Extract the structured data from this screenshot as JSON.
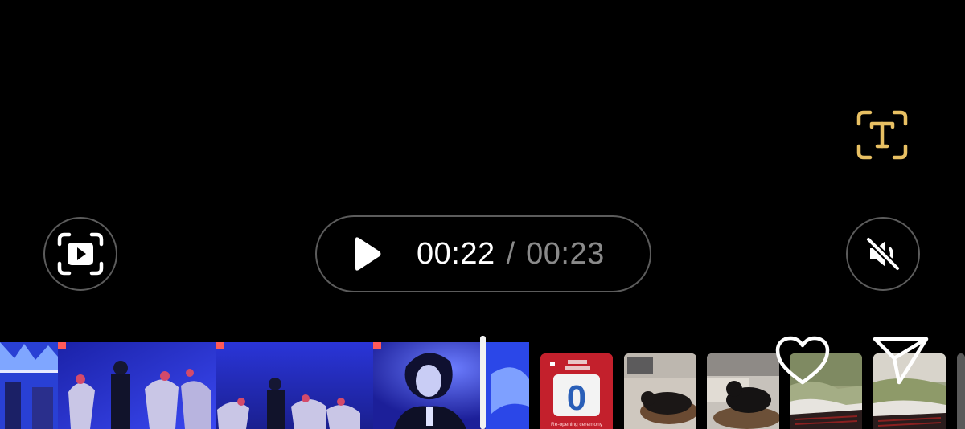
{
  "player": {
    "current_time": "00:22",
    "separator": "/",
    "total_time": "00:23"
  },
  "controls": {
    "ocr_icon": "text-recognition-icon",
    "capture_icon": "screen-capture-icon",
    "play_icon": "play-icon",
    "mute_icon": "volume-muted-icon",
    "heart_icon": "heart-icon",
    "share_icon": "send-icon"
  },
  "gallery": {
    "poster": {
      "number": "0",
      "caption": "Re-opening ceremony"
    }
  },
  "colors": {
    "background": "#000000",
    "accent_ocr": "#e8c063",
    "border": "#5c5c5c",
    "time_primary": "#ffffff",
    "time_secondary": "#8a8a8a"
  }
}
